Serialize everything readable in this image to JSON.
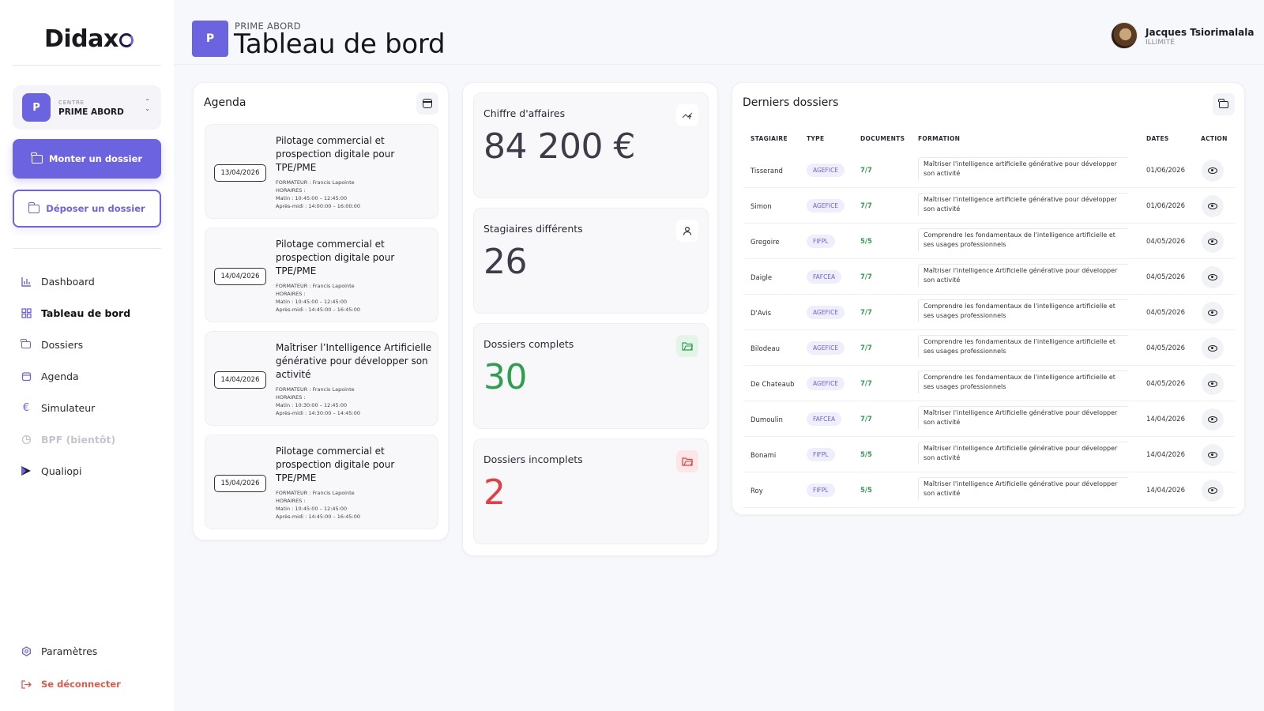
{
  "brand": {
    "logo_text": "Didax"
  },
  "colors": {
    "accent": "#6c63e0",
    "success": "#2e9e4f",
    "danger": "#e53e3e",
    "neutral_value": "#3d3d4a"
  },
  "sidebar": {
    "centre_kicker": "CENTRE",
    "centre_name": "PRIME ABORD",
    "centre_badge": "P",
    "primary_button": "Monter un dossier",
    "secondary_button": "Déposer un dossier",
    "items": [
      {
        "label": "Dashboard",
        "icon": "bar-chart-icon"
      },
      {
        "label": "Tableau de bord",
        "icon": "grid-icon",
        "active": true
      },
      {
        "label": "Dossiers",
        "icon": "folder-icon"
      },
      {
        "label": "Agenda",
        "icon": "calendar-icon"
      },
      {
        "label": "Simulateur",
        "icon": "euro-icon"
      },
      {
        "label": "BPF (bientôt)",
        "icon": "pie-chart-icon",
        "disabled": true
      },
      {
        "label": "Qualiopi",
        "icon": "qualiopi-icon"
      }
    ],
    "settings_label": "Paramètres",
    "logout_label": "Se déconnecter"
  },
  "header": {
    "badge": "P",
    "kicker": "PRIME ABORD",
    "title": "Tableau de bord",
    "user_name": "Jacques Tsiorimalala",
    "user_plan": "ILLIMITÉ"
  },
  "agenda": {
    "title": "Agenda",
    "events": [
      {
        "date": "13/04/2026",
        "title": "Pilotage commercial et prospection digitale pour TPE/PME",
        "trainer": "FORMATEUR : Francis Lapointe",
        "hours_label": "HORAIRES :",
        "morning": "Matin : 10:45:00 – 12:45:00",
        "afternoon": "Après-midi : 14:00:00 – 16:00:00"
      },
      {
        "date": "14/04/2026",
        "title": "Pilotage commercial et prospection digitale pour TPE/PME",
        "trainer": "FORMATEUR : Francis Lapointe",
        "hours_label": "HORAIRES :",
        "morning": "Matin : 10:45:00 – 12:45:00",
        "afternoon": "Après-midi : 14:45:00 – 16:45:00"
      },
      {
        "date": "14/04/2026",
        "title": "Maîtriser l’Intelligence Artificielle générative pour développer son activité",
        "trainer": "FORMATEUR : Francis Lapointe",
        "hours_label": "HORAIRES :",
        "morning": "Matin : 10:30:00 – 12:45:00",
        "afternoon": "Après-midi : 14:30:00 – 14:45:00"
      },
      {
        "date": "15/04/2026",
        "title": "Pilotage commercial et prospection digitale pour TPE/PME",
        "trainer": "FORMATEUR : Francis Lapointe",
        "hours_label": "HORAIRES :",
        "morning": "Matin : 10:45:00 – 12:45:00",
        "afternoon": "Après-midi : 14:45:00 – 16:45:00"
      }
    ]
  },
  "stats": [
    {
      "label": "Chiffre d'affaires",
      "value": "84 200 €",
      "icon": "trend-up-icon",
      "color": "#3d3d4a"
    },
    {
      "label": "Stagiaires différents",
      "value": "26",
      "icon": "user-icon",
      "color": "#3d3d4a"
    },
    {
      "label": "Dossiers complets",
      "value": "30",
      "icon": "folder-check-icon",
      "color": "#2e9e4f"
    },
    {
      "label": "Dossiers incomplets",
      "value": "2",
      "icon": "folder-alert-icon",
      "color": "#e53e3e"
    }
  ],
  "dossiers": {
    "title": "Derniers dossiers",
    "columns": [
      "STAGIAIRE",
      "TYPE",
      "DOCUMENTS",
      "FORMATION",
      "DATES",
      "ACTION"
    ],
    "rows": [
      {
        "stagiaire": "Tisserand",
        "type": "AGEFICE",
        "docs": "7/7",
        "formation": "Maîtriser l'intelligence artificielle générative pour développer son activité",
        "date": "01/06/2026"
      },
      {
        "stagiaire": "Simon",
        "type": "AGEFICE",
        "docs": "7/7",
        "formation": "Maîtriser l'intelligence artificielle générative pour développer son activité",
        "date": "01/06/2026"
      },
      {
        "stagiaire": "Gregoire",
        "type": "FIFPL",
        "docs": "5/5",
        "formation": "Comprendre les fondamentaux de l'intelligence artificielle et ses usages professionnels",
        "date": "04/05/2026"
      },
      {
        "stagiaire": "Daigle",
        "type": "FAFCEA",
        "docs": "7/7",
        "formation": "Maîtriser l'intelligence Artificielle générative pour développer son activité",
        "date": "04/05/2026"
      },
      {
        "stagiaire": "D'Avis",
        "type": "AGEFICE",
        "docs": "7/7",
        "formation": "Comprendre les fondamentaux de l'intelligence artificielle et ses usages professionnels",
        "date": "04/05/2026"
      },
      {
        "stagiaire": "Bilodeau",
        "type": "AGEFICE",
        "docs": "7/7",
        "formation": "Comprendre les fondamentaux de l'intelligence artificielle et ses usages professionnels",
        "date": "04/05/2026"
      },
      {
        "stagiaire": "De Chateaub",
        "type": "AGEFICE",
        "docs": "7/7",
        "formation": "Comprendre les fondamentaux de l'intelligence artificielle et ses usages professionnels",
        "date": "04/05/2026"
      },
      {
        "stagiaire": "Dumoulin",
        "type": "FAFCEA",
        "docs": "7/7",
        "formation": "Maîtriser l'intelligence Artificielle générative pour développer son activité",
        "date": "14/04/2026"
      },
      {
        "stagiaire": "Bonami",
        "type": "FIFPL",
        "docs": "5/5",
        "formation": "Maîtriser l'intelligence Artificielle générative pour développer son activité",
        "date": "14/04/2026"
      },
      {
        "stagiaire": "Roy",
        "type": "FIFPL",
        "docs": "5/5",
        "formation": "Maîtriser l'intelligence Artificielle générative pour développer son activité",
        "date": "14/04/2026"
      }
    ]
  }
}
